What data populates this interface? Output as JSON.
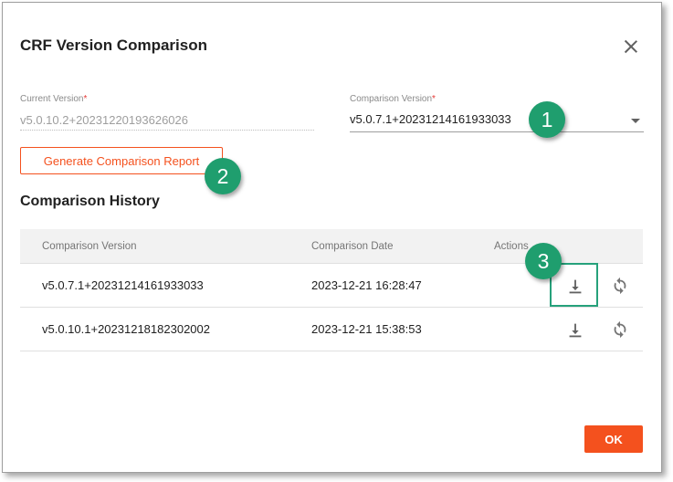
{
  "dialog": {
    "title": "CRF Version Comparison",
    "close_icon": "close-icon"
  },
  "form": {
    "current_version": {
      "label": "Current Version",
      "required_mark": "*",
      "value": "v5.0.10.2+20231220193626026"
    },
    "comparison_version": {
      "label": "Comparison Version",
      "required_mark": "*",
      "value": "v5.0.7.1+20231214161933033"
    },
    "generate_button": "Generate Comparison Report"
  },
  "history": {
    "title": "Comparison History",
    "columns": [
      "Comparison Version",
      "Comparison Date",
      "Actions"
    ],
    "rows": [
      {
        "version": "v5.0.7.1+20231214161933033",
        "date": "2023-12-21 16:28:47",
        "actions": [
          "download-icon",
          "refresh-icon"
        ]
      },
      {
        "version": "v5.0.10.1+20231218182302002",
        "date": "2023-12-21 15:38:53",
        "actions": [
          "download-icon",
          "refresh-icon"
        ]
      }
    ]
  },
  "callouts": [
    "1",
    "2",
    "3"
  ],
  "footer": {
    "ok_label": "OK"
  },
  "colors": {
    "accent": "#f4511e",
    "callout": "#1f9e6e",
    "highlight": "#26a17b"
  }
}
